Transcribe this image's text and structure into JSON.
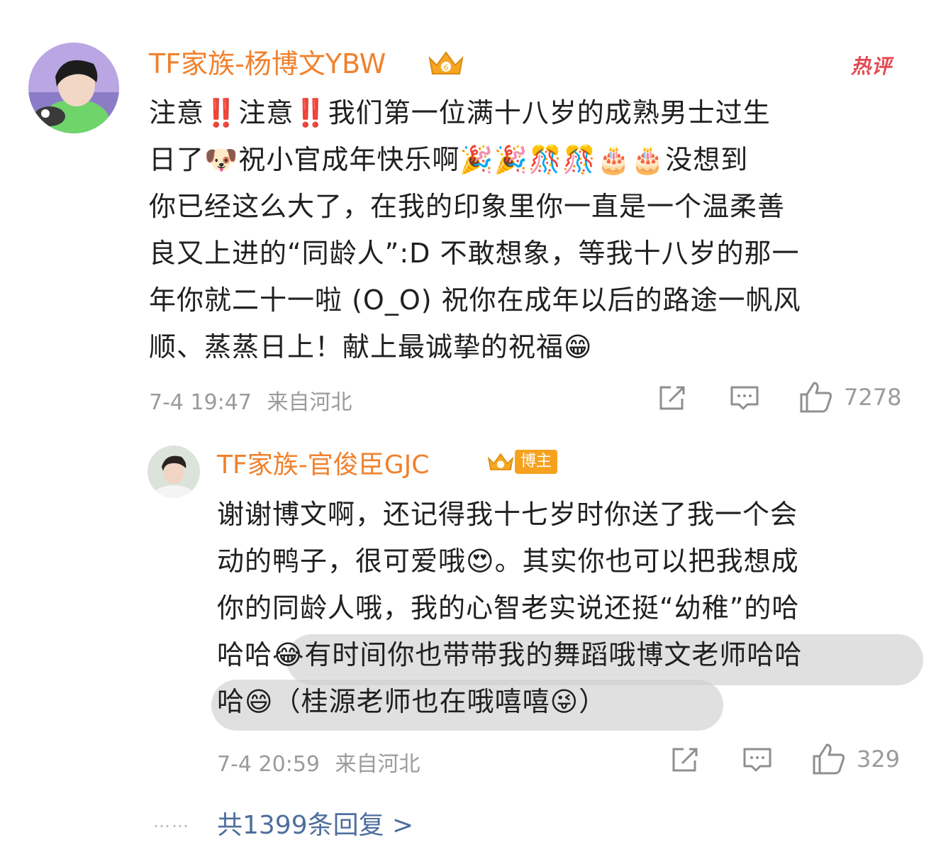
{
  "comment": {
    "username": "TF家族-杨博文YBW",
    "hot_tag": "热评",
    "lines": [
      [
        "注意",
        "‼️",
        "注意",
        "‼️",
        "我们第一位满十八岁的成熟男士过生"
      ],
      [
        "日了",
        "🐶",
        "祝小官成年快乐啊",
        "🎉🎉🎊🎊🎂🎂",
        "没想到"
      ],
      [
        "你已经这么大了，在我的印象里你一直是一个温柔善"
      ],
      [
        "良又上进的“同龄人”:D 不敢想象，等我十八岁的那一"
      ],
      [
        "年你就二十一啦 (O_O) 祝你在成年以后的路途一帆风"
      ],
      [
        "顺、蒸蒸日上！献上最诚挚的祝福",
        "😁"
      ]
    ],
    "time": "7-4 19:47",
    "location": "来自河北",
    "like_count": "7278"
  },
  "reply": {
    "username": "TF家族-官俊臣GJC",
    "badge": "博主",
    "lines": [
      [
        "谢谢博文啊，还记得我十七岁时你送了我一个会"
      ],
      [
        "动的鸭子，很可爱哦",
        "😍",
        "。其实你也可以把我想成"
      ],
      [
        "你的同龄人哦，我的心智老实说还挺“幼稚”的哈"
      ],
      [
        "哈哈",
        "😂",
        "有时间你也带带我的舞蹈哦博文老师哈哈"
      ],
      [
        "哈",
        "😄",
        "（桂源老师也在哦嘻嘻",
        "😜",
        "）"
      ]
    ],
    "time": "7-4 20:59",
    "location": "来自河北",
    "like_count": "329"
  },
  "footer": {
    "dots": "……",
    "replies_label": "共1399条回复 >"
  },
  "colors": {
    "username": "#f0812d",
    "meta": "#9b9b9b",
    "link": "#4e6e9e",
    "hot": "#e24b53"
  },
  "icons": [
    "share-icon",
    "comment-icon",
    "like-icon",
    "crown-badge-icon"
  ]
}
